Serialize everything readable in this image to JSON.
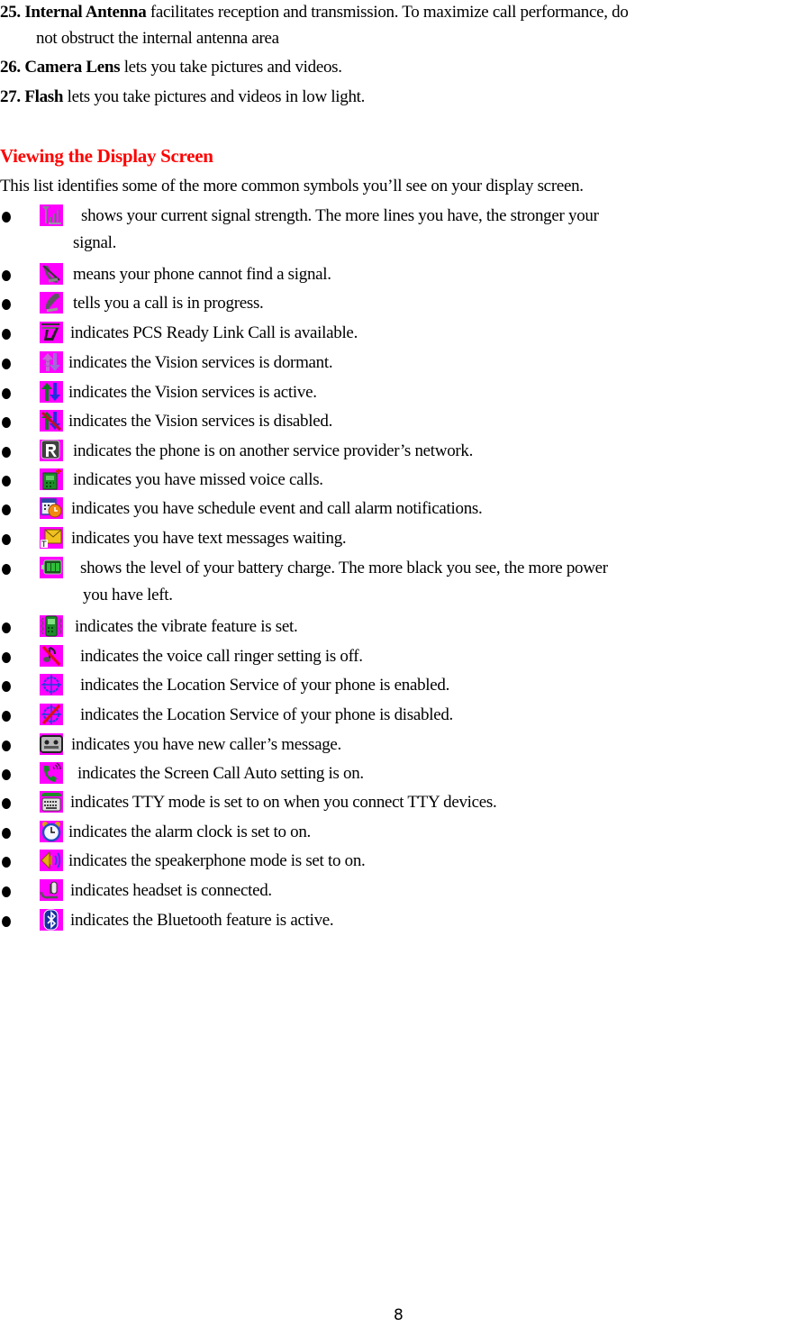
{
  "numbered_items": [
    {
      "number": "25.",
      "term": "Internal Antenna",
      "text": " facilitates reception and transmission. To maximize call performance, do",
      "continuation": "not obstruct the internal antenna area"
    },
    {
      "number": "26.",
      "term": "Camera Lens",
      "text": " lets you take pictures and videos."
    },
    {
      "number": "27.",
      "term": "Flash",
      "text": " lets you take pictures and videos in low light."
    }
  ],
  "section": {
    "title": "Viewing the Display Screen",
    "intro": "This list identifies some of the more common symbols you’ll see on your display screen.",
    "title_color": "#ff0000"
  },
  "icon_background": "#ff00ff",
  "symbols": [
    {
      "icon": "signal-strength-icon",
      "text": "shows your current signal strength. The more lines you have, the stronger your",
      "continuation": "signal."
    },
    {
      "icon": "no-signal-icon",
      "text": "means your phone cannot find a signal."
    },
    {
      "icon": "call-in-progress-icon",
      "text": "tells you a call is in progress."
    },
    {
      "icon": "ready-link-icon",
      "text": "indicates PCS Ready Link Call is available."
    },
    {
      "icon": "vision-dormant-icon",
      "text": "indicates the Vision services is dormant."
    },
    {
      "icon": "vision-active-icon",
      "text": "indicates the Vision services is active."
    },
    {
      "icon": "vision-disabled-icon",
      "text": "indicates the Vision services is disabled."
    },
    {
      "icon": "roaming-icon",
      "text": "indicates the phone is on another service provider’s network."
    },
    {
      "icon": "missed-call-icon",
      "text": "indicates you have missed voice calls."
    },
    {
      "icon": "schedule-alarm-icon",
      "text": "indicates you have schedule event and call alarm notifications."
    },
    {
      "icon": "text-message-icon",
      "text": "indicates you have text messages waiting."
    },
    {
      "icon": "battery-icon",
      "text": "shows the level of your battery charge. The more black you see, the more power",
      "continuation": "you have left."
    },
    {
      "icon": "vibrate-icon",
      "text": "indicates the vibrate feature is set."
    },
    {
      "icon": "ringer-off-icon",
      "text": "indicates the voice call ringer setting is off."
    },
    {
      "icon": "location-on-icon",
      "text": "indicates the Location Service of your phone is enabled."
    },
    {
      "icon": "location-off-icon",
      "text": "indicates the Location Service of your phone is disabled."
    },
    {
      "icon": "caller-message-icon",
      "text": "indicates you have new caller’s message."
    },
    {
      "icon": "screen-call-auto-icon",
      "text": "indicates the Screen Call Auto setting is on."
    },
    {
      "icon": "tty-icon",
      "text": "indicates TTY mode is set to on when you connect TTY devices."
    },
    {
      "icon": "alarm-clock-icon",
      "text": "indicates the alarm clock is set to on."
    },
    {
      "icon": "speakerphone-icon",
      "text": "indicates the speakerphone mode is set to on."
    },
    {
      "icon": "headset-icon",
      "text": "indicates headset is connected."
    },
    {
      "icon": "bluetooth-icon",
      "text": "indicates the Bluetooth feature is active."
    }
  ],
  "page_number": "8"
}
